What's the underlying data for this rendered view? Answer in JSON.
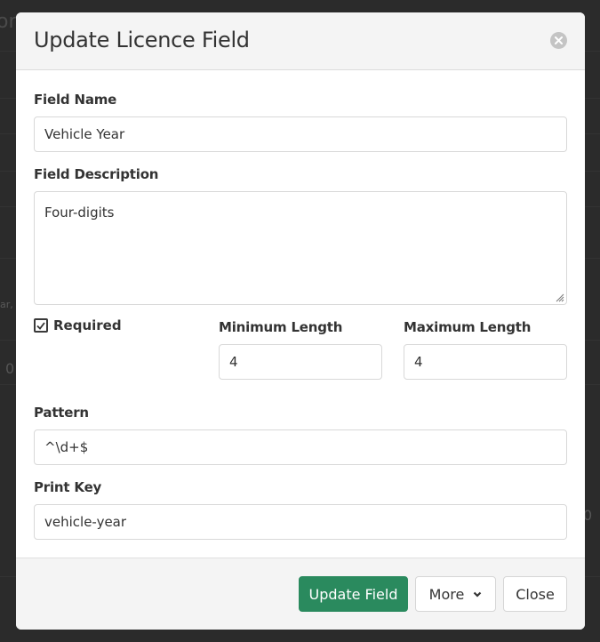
{
  "background": {
    "title_fragment": "ory",
    "snippet_fragment": "ar,",
    "number_left": "0",
    "number_right": "0"
  },
  "modal": {
    "title": "Update Licence Field",
    "close_icon": "close-circle-icon",
    "fields": {
      "field_name": {
        "label": "Field Name",
        "value": "Vehicle Year"
      },
      "field_description": {
        "label": "Field Description",
        "value": "Four-digits"
      },
      "required": {
        "label": "Required",
        "checked": true
      },
      "minimum_length": {
        "label": "Minimum Length",
        "value": "4"
      },
      "maximum_length": {
        "label": "Maximum Length",
        "value": "4"
      },
      "pattern": {
        "label": "Pattern",
        "value": "^\\d+$"
      },
      "print_key": {
        "label": "Print Key",
        "value": "vehicle-year"
      }
    },
    "footer": {
      "update_label": "Update Field",
      "more_label": "More",
      "close_label": "Close"
    },
    "colors": {
      "primary": "#2a8a5e",
      "header_bg": "#f4f4f4",
      "overlay_bg": "#2a2a2a"
    }
  }
}
